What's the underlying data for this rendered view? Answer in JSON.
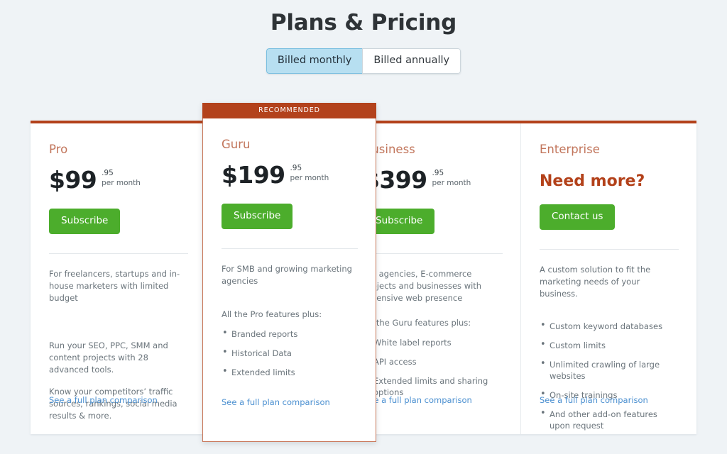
{
  "header": {
    "title": "Plans & Pricing",
    "billing_toggle": {
      "options": [
        {
          "label": "Billed monthly",
          "active": true
        },
        {
          "label": "Billed annually",
          "active": false
        }
      ]
    }
  },
  "colors": {
    "page_background": "#eff3f6",
    "card_top_border": "#b3411a",
    "ribbon_background": "#b3421c",
    "plan_name": "#c2765c",
    "cta_green": "#4cad2c",
    "link_blue": "#4a8fd0",
    "toggle_active": "#b7dff1",
    "need_more_red": "#b3411a"
  },
  "plans": [
    {
      "id": "pro",
      "name": "Pro",
      "price_main": "$99",
      "price_cents": ".95",
      "price_period": "per month",
      "cta_label": "Subscribe",
      "blurbs": [
        "For freelancers, startups and in-house marketers with limited budget",
        "Run your SEO, PPC, SMM and content projects with 28 advanced tools.",
        "Know your competitors’ traffic sources, rankings, social media results & more."
      ],
      "features_intro": "",
      "features": [],
      "compare_link": "See a full plan comparison",
      "recommended": false
    },
    {
      "id": "guru",
      "name": "Guru",
      "ribbon_label": "RECOMMENDED",
      "price_main": "$199",
      "price_cents": ".95",
      "price_period": "per month",
      "cta_label": "Subscribe",
      "blurbs": [
        "For SMB and growing marketing agencies"
      ],
      "features_intro": "All the Pro features plus:",
      "features": [
        "Branded reports",
        "Historical Data",
        "Extended limits"
      ],
      "compare_link": "See a full plan comparison",
      "recommended": true
    },
    {
      "id": "business",
      "name": "Business",
      "price_main": "$399",
      "price_cents": ".95",
      "price_period": "per month",
      "cta_label": "Subscribe",
      "blurbs": [
        "For agencies, E-commerce projects and businesses with extensive web presence"
      ],
      "features_intro": "All the Guru features plus:",
      "features": [
        "White label reports",
        "API access",
        "Extended limits and sharing options"
      ],
      "compare_link": "See a full plan comparison",
      "recommended": false
    },
    {
      "id": "enterprise",
      "name": "Enterprise",
      "headline": "Need more?",
      "cta_label": "Contact us",
      "blurbs": [
        "A custom solution to fit the marketing needs of your business."
      ],
      "features_intro": "",
      "features": [
        "Custom keyword databases",
        "Custom limits",
        "Unlimited crawling of large websites",
        "On-site trainings",
        "And other add-on features upon request"
      ],
      "compare_link": "See a full plan comparison",
      "recommended": false
    }
  ]
}
